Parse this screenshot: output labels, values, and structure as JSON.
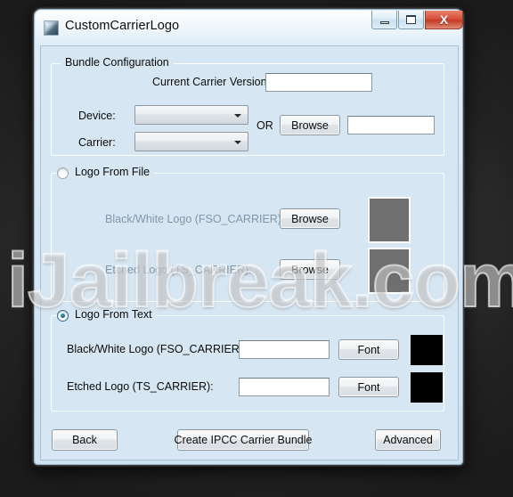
{
  "window": {
    "title": "CustomCarrierLogo",
    "icon": "app-logo-icon",
    "controls": {
      "minimize": "minimize-icon",
      "maximize": "maximize-icon",
      "close": "X"
    }
  },
  "watermark": {
    "text": "iJailbreak.com"
  },
  "bundle_configuration": {
    "legend": "Bundle Configuration",
    "carrier_version_label": "Current Carrier Version:",
    "carrier_version_value": "",
    "device_label": "Device:",
    "device_value": "",
    "carrier_label": "Carrier:",
    "carrier_value": "",
    "or_label": "OR",
    "browse_label": "Browse",
    "browse_path_value": ""
  },
  "logo_from_file": {
    "legend": "Logo From File",
    "selected": false,
    "rows": [
      {
        "label": "Black/White Logo  (FSO_CARRIER):",
        "button": "Browse",
        "preview_color": "#6f6f6f"
      },
      {
        "label": "Etched Logo (TS_CARRIER):",
        "button": "Browse",
        "preview_color": "#6f6f6f"
      }
    ]
  },
  "logo_from_text": {
    "legend": "Logo From Text",
    "selected": true,
    "rows": [
      {
        "label": "Black/White Logo  (FSO_CARRIER):",
        "value": "",
        "button": "Font",
        "swatch_color": "#000000"
      },
      {
        "label": "Etched Logo (TS_CARRIER):",
        "value": "",
        "button": "Font",
        "swatch_color": "#000000"
      }
    ]
  },
  "footer": {
    "back_label": "Back",
    "create_label": "Create IPCC Carrier Bundle",
    "advanced_label": "Advanced"
  },
  "colors": {
    "client_background": "#d6e6f2",
    "disabled_text": "#8296a8",
    "close_button": "#c23b26"
  }
}
